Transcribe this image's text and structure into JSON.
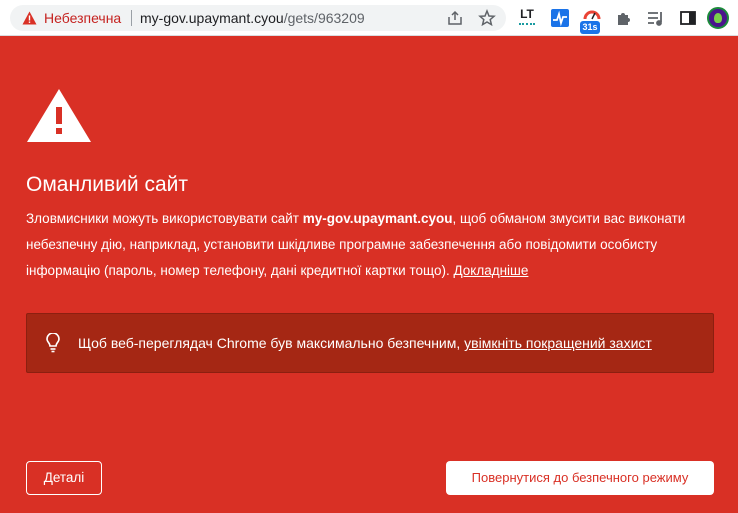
{
  "browser": {
    "security_label": "Небезпечна",
    "url_host": "my-gov.upaymant.cyou",
    "url_path": "/gets/963209",
    "extensions": [
      "languagetool-icon",
      "pulse-chart-icon",
      "timer-31s-icon",
      "puzzle-extensions-icon",
      "media-queue-icon",
      "side-panel-icon",
      "profile-avatar"
    ],
    "timer_badge": "31s",
    "extension_lt_label": "LT"
  },
  "interstitial": {
    "heading": "Оманливий сайт",
    "body_prefix": "Зловмисники можуть використовувати сайт ",
    "body_domain": "my-gov.upaymant.cyou",
    "body_suffix": ", щоб обманом змусити вас виконати небезпечну дію, наприклад, установити шкідливе програмне забезпечення або повідомити особисту інформацію (пароль, номер телефону, дані кредитної картки тощо). ",
    "learn_more": "Докладніше",
    "protection_text": "Щоб веб-переглядач Chrome був максимально безпечним, ",
    "protection_link": "увімкніть покращений захист",
    "details_button": "Деталі",
    "back_button": "Повернутися до безпечного режиму"
  },
  "colors": {
    "background": "#d93025",
    "protection_box": "#a52714",
    "back_button_text": "#d93025"
  }
}
